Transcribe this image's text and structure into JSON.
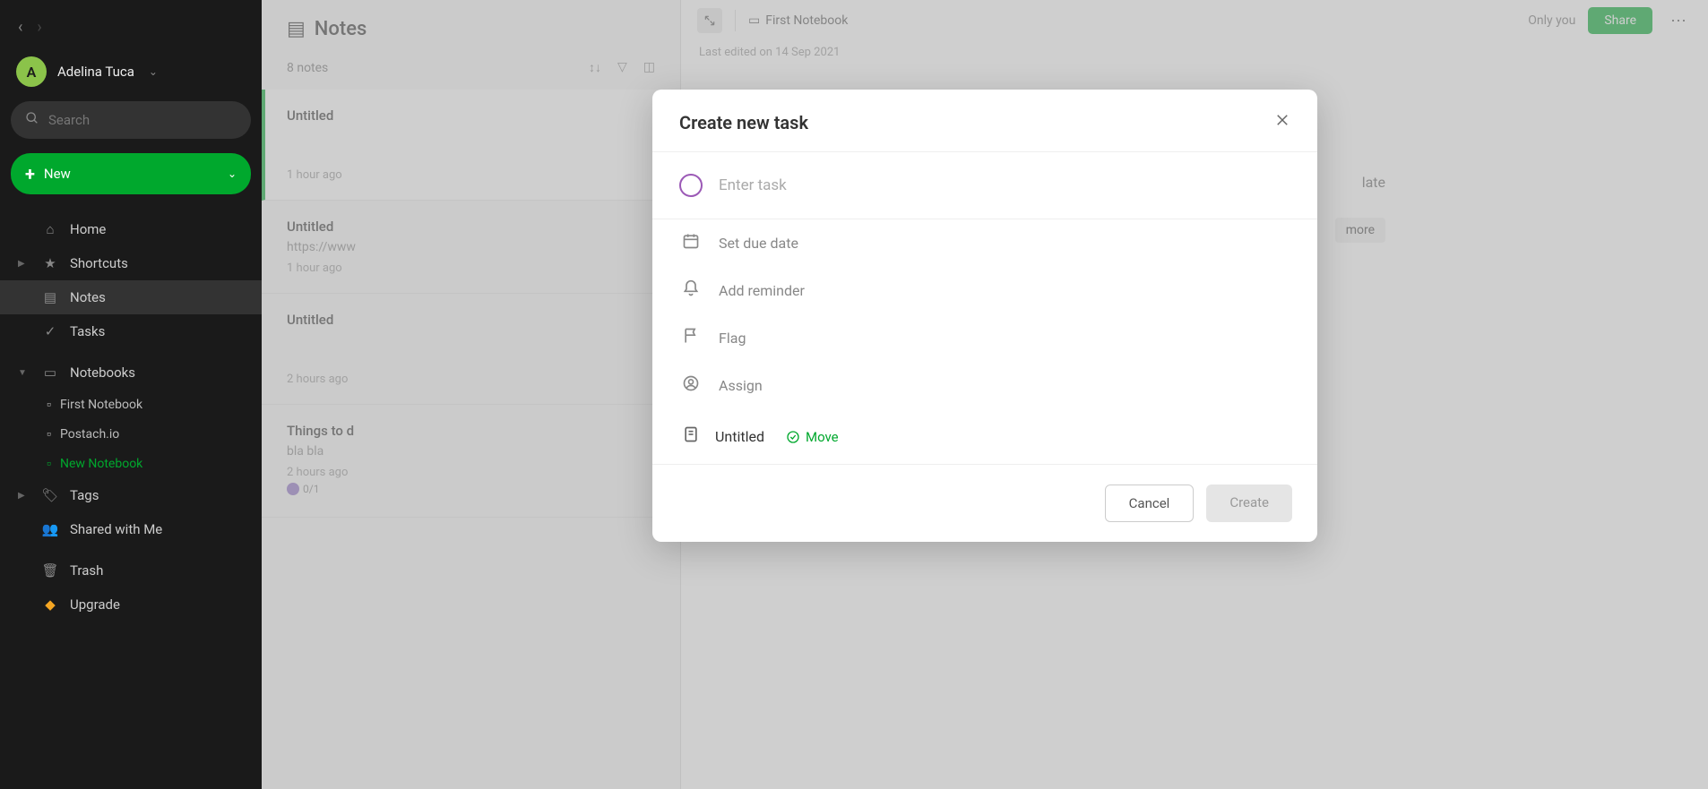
{
  "sidebar": {
    "user_initial": "A",
    "user_name": "Adelina Tuca",
    "search_placeholder": "Search",
    "new_label": "New",
    "items": {
      "home": "Home",
      "shortcuts": "Shortcuts",
      "notes": "Notes",
      "tasks": "Tasks",
      "notebooks": "Notebooks",
      "tags": "Tags",
      "shared": "Shared with Me",
      "trash": "Trash",
      "upgrade": "Upgrade"
    },
    "notebooks_children": [
      "First Notebook",
      "Postach.io",
      "New Notebook"
    ]
  },
  "notes_panel": {
    "title": "Notes",
    "count": "8 notes",
    "cards": [
      {
        "title": "Untitled",
        "preview": "",
        "time": "1 hour ago",
        "selected": true,
        "tasks": ""
      },
      {
        "title": "Untitled",
        "preview": "https://www",
        "time": "1 hour ago",
        "selected": false,
        "tasks": ""
      },
      {
        "title": "Untitled",
        "preview": "",
        "time": "2 hours ago",
        "selected": false,
        "tasks": ""
      },
      {
        "title": "Things to d",
        "preview": "bla bla",
        "time": "2 hours ago",
        "selected": false,
        "tasks": "0/1"
      }
    ]
  },
  "editor": {
    "notebook": "First Notebook",
    "only_you": "Only you",
    "share": "Share",
    "last_edited": "Last edited on 14 Sep 2021",
    "hint_more": "more"
  },
  "modal": {
    "title": "Create new task",
    "task_placeholder": "Enter task",
    "options": {
      "due": "Set due date",
      "reminder": "Add reminder",
      "flag": "Flag",
      "assign": "Assign"
    },
    "note_name": "Untitled",
    "move": "Move",
    "cancel": "Cancel",
    "create": "Create"
  }
}
